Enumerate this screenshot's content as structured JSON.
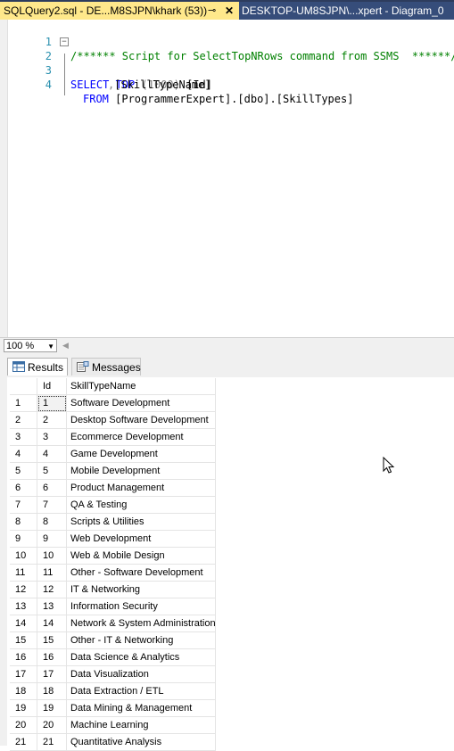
{
  "tabs": [
    {
      "label": "SQLQuery2.sql - DE...M8SJPN\\khark (53))",
      "active": true,
      "pin": "⊸",
      "close": "✕"
    },
    {
      "label": "DESKTOP-UM8SJPN\\...xpert - Diagram_0",
      "active": false
    }
  ],
  "editor": {
    "lines": [
      {
        "num": "1",
        "comment": "/****** Script for SelectTopNRows command from SSMS  ******/"
      },
      {
        "num": "2",
        "kw1": "SELECT",
        "kw2": "TOP",
        "paren": "(1000)",
        "rest": " [Id]"
      },
      {
        "num": "3",
        "sep": ",",
        "rest": "[SkillTypeName]"
      },
      {
        "num": "4",
        "kw1": "FROM",
        "rest": " [ProgrammerExpert].[dbo].[SkillTypes]"
      }
    ]
  },
  "zoom": {
    "value": "100 %"
  },
  "results_tabs": [
    {
      "label": "Results",
      "active": true
    },
    {
      "label": "Messages",
      "active": false
    }
  ],
  "grid": {
    "columns": [
      "",
      "Id",
      "SkillTypeName"
    ],
    "rows": [
      [
        "1",
        "1",
        "Software Development"
      ],
      [
        "2",
        "2",
        "Desktop Software Development"
      ],
      [
        "3",
        "3",
        "Ecommerce Development"
      ],
      [
        "4",
        "4",
        "Game Development"
      ],
      [
        "5",
        "5",
        "Mobile Development"
      ],
      [
        "6",
        "6",
        "Product Management"
      ],
      [
        "7",
        "7",
        "QA & Testing"
      ],
      [
        "8",
        "8",
        "Scripts & Utilities"
      ],
      [
        "9",
        "9",
        "Web Development"
      ],
      [
        "10",
        "10",
        "Web & Mobile Design"
      ],
      [
        "11",
        "11",
        "Other - Software Development"
      ],
      [
        "12",
        "12",
        "IT & Networking"
      ],
      [
        "13",
        "13",
        "Information Security"
      ],
      [
        "14",
        "14",
        "Network & System Administration"
      ],
      [
        "15",
        "15",
        "Other - IT & Networking"
      ],
      [
        "16",
        "16",
        "Data Science & Analytics"
      ],
      [
        "17",
        "17",
        "Data Visualization"
      ],
      [
        "18",
        "18",
        "Data Extraction / ETL"
      ],
      [
        "19",
        "19",
        "Data Mining & Management"
      ],
      [
        "20",
        "20",
        "Machine Learning"
      ],
      [
        "21",
        "21",
        "Quantitative Analysis"
      ]
    ]
  }
}
